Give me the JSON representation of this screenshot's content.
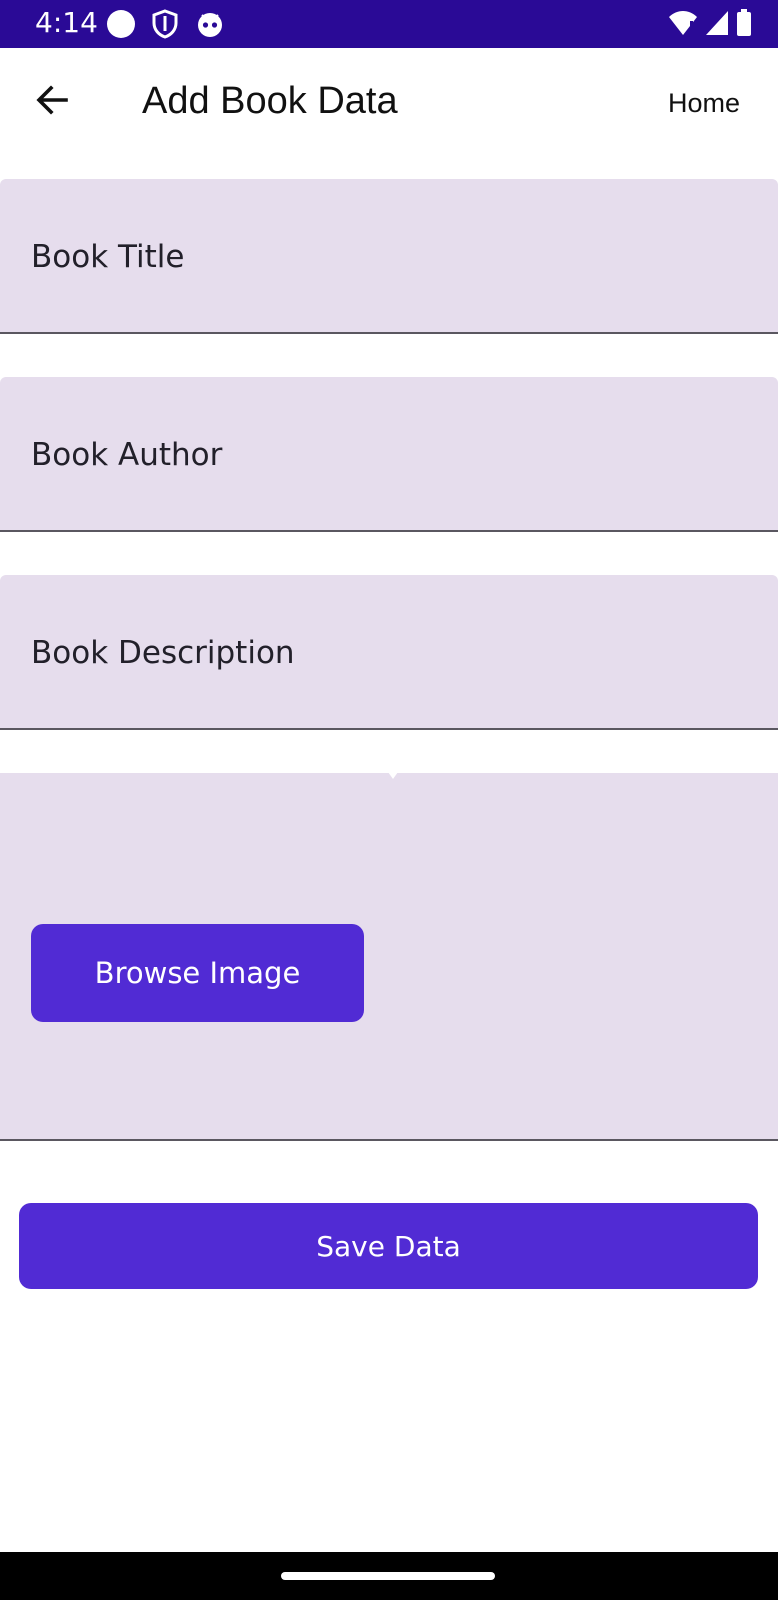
{
  "status_bar": {
    "time": "4:14",
    "background": "#2a0a96",
    "left_icons": [
      "circle-icon",
      "shield-icon",
      "robot-icon"
    ],
    "right_icons": [
      "wifi-icon",
      "signal-icon",
      "battery-icon"
    ]
  },
  "app_bar": {
    "title": "Add Book Data",
    "home_label": "Home",
    "back_icon": "arrow-back-icon"
  },
  "form": {
    "fields": [
      {
        "label": "Book Title"
      },
      {
        "label": "Book Author"
      },
      {
        "label": "Book Description"
      }
    ],
    "browse_button_label": "Browse Image",
    "save_button_label": "Save Data"
  },
  "colors": {
    "accent": "#512bd4",
    "field_background": "#e6dded",
    "status_bar": "#2a0a96"
  }
}
